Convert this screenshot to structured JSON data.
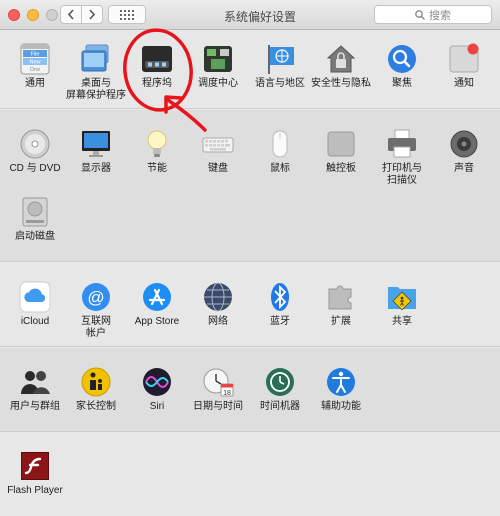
{
  "window": {
    "title": "系统偏好设置",
    "search_placeholder": "搜索"
  },
  "row1": [
    {
      "label": "通用"
    },
    {
      "label": "桌面与\n屏幕保护程序"
    },
    {
      "label": "程序坞"
    },
    {
      "label": "调度中心"
    },
    {
      "label": "语言与地区"
    },
    {
      "label": "安全性与隐私"
    },
    {
      "label": "聚焦"
    },
    {
      "label": "通知"
    }
  ],
  "general_icon_text": "File\nNew\nOne",
  "row2": [
    {
      "label": "CD 与 DVD"
    },
    {
      "label": "显示器"
    },
    {
      "label": "节能"
    },
    {
      "label": "键盘"
    },
    {
      "label": "鼠标"
    },
    {
      "label": "触控板"
    },
    {
      "label": "打印机与\n扫描仪"
    },
    {
      "label": "声音"
    }
  ],
  "row2b": [
    {
      "label": "启动磁盘"
    }
  ],
  "row3": [
    {
      "label": "iCloud"
    },
    {
      "label": "互联网\n帐户"
    },
    {
      "label": "App Store"
    },
    {
      "label": "网络"
    },
    {
      "label": "蓝牙"
    },
    {
      "label": "扩展"
    },
    {
      "label": "共享"
    }
  ],
  "row4": [
    {
      "label": "用户与群组"
    },
    {
      "label": "家长控制"
    },
    {
      "label": "Siri"
    },
    {
      "label": "日期与时间"
    },
    {
      "label": "时间机器"
    },
    {
      "label": "辅助功能"
    }
  ],
  "calendar_icon_text": "18",
  "row5": [
    {
      "label": "Flash Player"
    }
  ],
  "colors": {
    "annotation": "#e8141c"
  }
}
